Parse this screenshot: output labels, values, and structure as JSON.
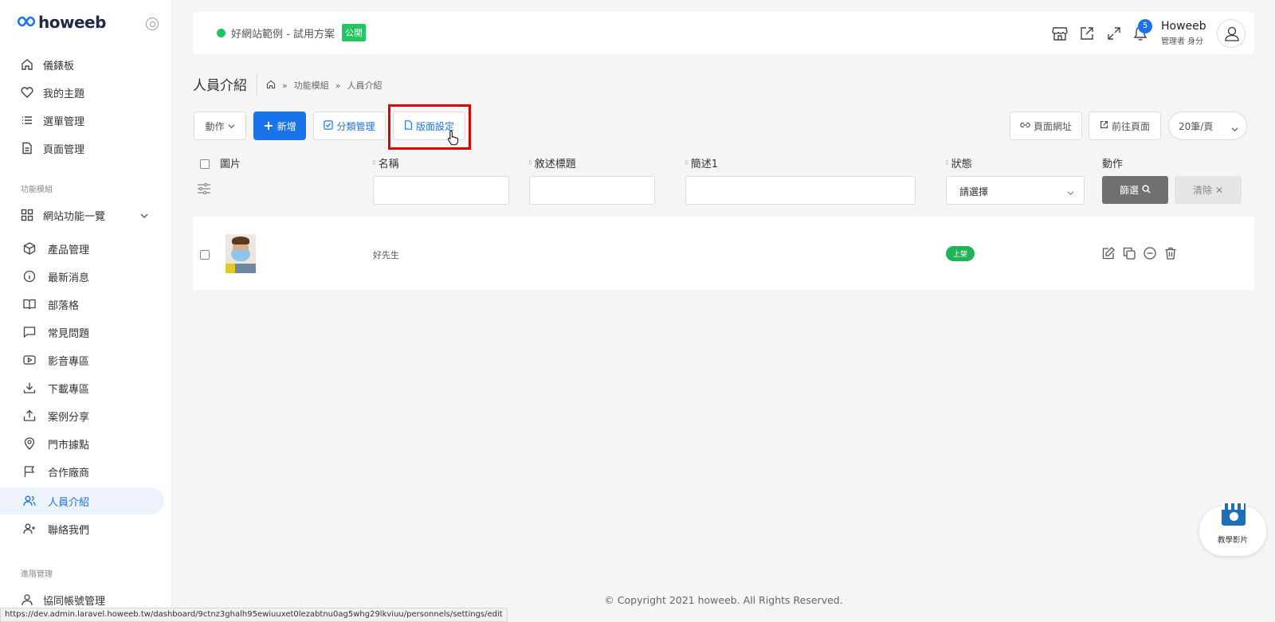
{
  "brand": {
    "logo_text": "howeeb"
  },
  "sidebar": {
    "items": [
      {
        "label": "儀錶板",
        "icon": "home-icon"
      },
      {
        "label": "我的主題",
        "icon": "heart-icon"
      },
      {
        "label": "選單管理",
        "icon": "list-icon"
      },
      {
        "label": "頁面管理",
        "icon": "file-icon"
      }
    ],
    "section_modules": "功能模組",
    "group_label": "網站功能一覽",
    "modules": [
      {
        "label": "產品管理",
        "icon": "box-icon"
      },
      {
        "label": "最新消息",
        "icon": "info-icon"
      },
      {
        "label": "部落格",
        "icon": "book-icon"
      },
      {
        "label": "常見問題",
        "icon": "chat-icon"
      },
      {
        "label": "影音專區",
        "icon": "video-icon"
      },
      {
        "label": "下載專區",
        "icon": "download-icon"
      },
      {
        "label": "案例分享",
        "icon": "share-icon"
      },
      {
        "label": "門市據點",
        "icon": "location-icon"
      },
      {
        "label": "合作廠商",
        "icon": "flag-icon"
      },
      {
        "label": "人員介紹",
        "icon": "users-icon",
        "active": true
      },
      {
        "label": "聯絡我們",
        "icon": "user-plus-icon"
      }
    ],
    "section_advanced": "進階管理",
    "advanced_items": [
      {
        "label": "協同帳號管理",
        "icon": "user-icon"
      }
    ]
  },
  "header": {
    "site_name": "好網站範例 - 試用方案",
    "public_badge": "公開",
    "notification_count": "5",
    "user_name": "Howeeb",
    "user_role": "管理者 身分"
  },
  "page": {
    "title": "人員介紹",
    "breadcrumb": [
      "功能模組",
      "人員介紹"
    ]
  },
  "toolbar": {
    "action_label": "動作",
    "add_label": "新增",
    "category_label": "分類管理",
    "layout_label": "版面設定",
    "page_url_label": "頁面網址",
    "goto_page_label": "前往頁面",
    "per_page_value": "20筆/頁"
  },
  "table": {
    "columns": [
      "圖片",
      "名稱",
      "敘述標題",
      "簡述1",
      "狀態",
      "動作"
    ],
    "status_placeholder": "請選擇",
    "filter_label": "篩選",
    "clear_label": "清除",
    "rows": [
      {
        "name": "好先生",
        "status": "上架"
      }
    ]
  },
  "footer": {
    "copyright": "© Copyright 2021 howeeb. All Rights Reserved.",
    "status_url": "https://dev.admin.laravel.howeeb.tw/dashboard/9ctnz3ghalh95ewiuuxet0lezabtnu0ag5whg29lkviuu/personnels/settings/edit"
  },
  "video_widget": {
    "label": "教學影片"
  },
  "colors": {
    "accent": "#1a73e8",
    "success": "#22c55e",
    "highlight": "#e00000"
  }
}
